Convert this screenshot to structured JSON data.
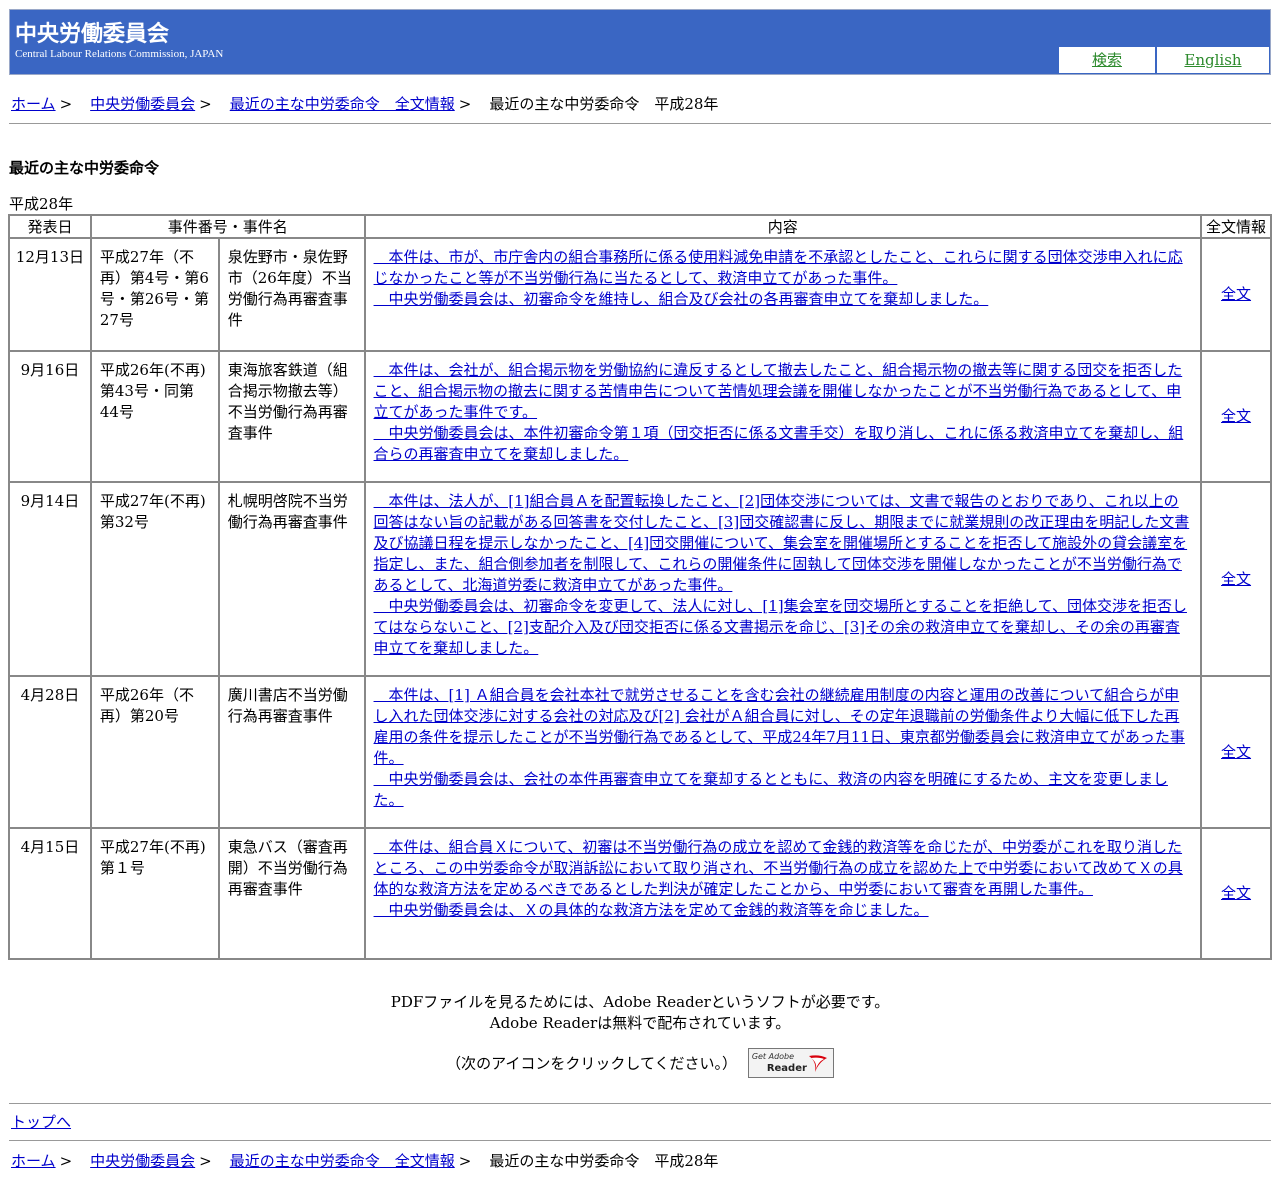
{
  "header": {
    "title": "中央労働委員会",
    "subtitle": "Central Labour Relations Commission, JAPAN",
    "nav": {
      "search": "検索",
      "english": "English"
    }
  },
  "breadcrumb": {
    "home": "ホーム",
    "commission": "中央労働委員会",
    "orders": "最近の主な中労委命令　全文情報",
    "current": "最近の主な中労委命令　平成28年",
    "separator": ">"
  },
  "page": {
    "heading": "最近の主な中労委命令",
    "year": "平成28年"
  },
  "table": {
    "headers": {
      "date": "発表日",
      "case": "事件番号・事件名",
      "content": "内容",
      "full": "全文情報"
    },
    "rows": [
      {
        "date": "12月13日",
        "case_no": "平成27年（不再）第4号・第6号・第26号・第27号",
        "case_name": "泉佐野市・泉佐野市（26年度）不当労働行為再審査事件",
        "content": [
          "　本件は、市が、市庁舎内の組合事務所に係る使用料減免申請を不承認としたこと、これらに関する団体交渉申入れに応じなかったこと等が不当労働行為に当たるとして、救済申立てがあった事件。",
          "　中央労働委員会は、初審命令を維持し、組合及び会社の各再審査申立てを棄却しました。"
        ],
        "full": "全文"
      },
      {
        "date": "9月16日",
        "case_no": "平成26年(不再)第43号・同第44号",
        "case_name": "東海旅客鉄道（組合掲示物撤去等）不当労働行為再審査事件",
        "content": [
          "　本件は、会社が、組合掲示物を労働協約に違反するとして撤去したこと、組合掲示物の撤去等に関する団交を拒否したこと、組合掲示物の撤去に関する苦情申告について苦情処理会議を開催しなかったことが不当労働行為であるとして、申立てがあった事件です。",
          "　中央労働委員会は、本件初審命令第１項（団交拒否に係る文書手交）を取り消し、これに係る救済申立てを棄却し、組合らの再審査申立てを棄却しました。"
        ],
        "full": "全文"
      },
      {
        "date": "9月14日",
        "case_no": "平成27年(不再)第32号",
        "case_name": "札幌明啓院不当労働行為再審査事件",
        "content": [
          "　本件は、法人が、[1]組合員Ａを配置転換したこと、[2]団体交渉については、文書で報告のとおりであり、これ以上の回答はない旨の記載がある回答書を交付したこと、[3]団交確認書に反し、期限までに就業規則の改正理由を明記した文書及び協議日程を提示しなかったこと、[4]団交開催について、集会室を開催場所とすることを拒否して施設外の貸会議室を指定し、また、組合側参加者を制限して、これらの開催条件に固執して団体交渉を開催しなかったことが不当労働行為であるとして、北海道労委に救済申立てがあった事件。",
          "　中央労働委員会は、初審命令を変更して、法人に対し、[1]集会室を団交場所とすることを拒絶して、団体交渉を拒否してはならないこと、[2]支配介入及び団交拒否に係る文書掲示を命じ、[3]その余の救済申立てを棄却し、その余の再審査申立てを棄却しました。"
        ],
        "full": "全文"
      },
      {
        "date": "4月28日",
        "case_no": "平成26年（不再）第20号",
        "case_name": "廣川書店不当労働行為再審査事件",
        "content": [
          "　本件は、[1] Ａ組合員を会社本社で就労させることを含む会社の継続雇用制度の内容と運用の改善について組合らが申し入れた団体交渉に対する会社の対応及び[2] 会社がＡ組合員に対し、その定年退職前の労働条件より大幅に低下した再雇用の条件を提示したことが不当労働行為であるとして、平成24年7月11日、東京都労働委員会に救済申立てがあった事件。",
          "　中央労働委員会は、会社の本件再審査申立てを棄却するとともに、救済の内容を明確にするため、主文を変更しました。"
        ],
        "full": "全文"
      },
      {
        "date": "4月15日",
        "case_no": "平成27年(不再)第１号",
        "case_name": "東急バス（審査再開）不当労働行為再審査事件",
        "content": [
          "　本件は、組合員Ｘについて、初審は不当労働行為の成立を認めて金銭的救済等を命じたが、中労委がこれを取り消したところ、この中労委命令が取消訴訟において取り消され、不当労働行為の成立を認めた上で中労委において改めてＸの具体的な救済方法を定めるべきであるとした判決が確定したことから、中労委において審査を再開した事件。",
          "　中央労働委員会は、Ｘの具体的な救済方法を定めて金銭的救済等を命じました。"
        ],
        "full": "全文"
      }
    ]
  },
  "pdf_notice": {
    "line1": "PDFファイルを見るためには、Adobe Readerというソフトが必要です。",
    "line2": "Adobe Readerは無料で配布されています。",
    "click": "（次のアイコンをクリックしてください。）",
    "badge_top": "Get Adobe",
    "badge_bottom": "Reader"
  },
  "footer": {
    "to_top": "トップへ"
  }
}
